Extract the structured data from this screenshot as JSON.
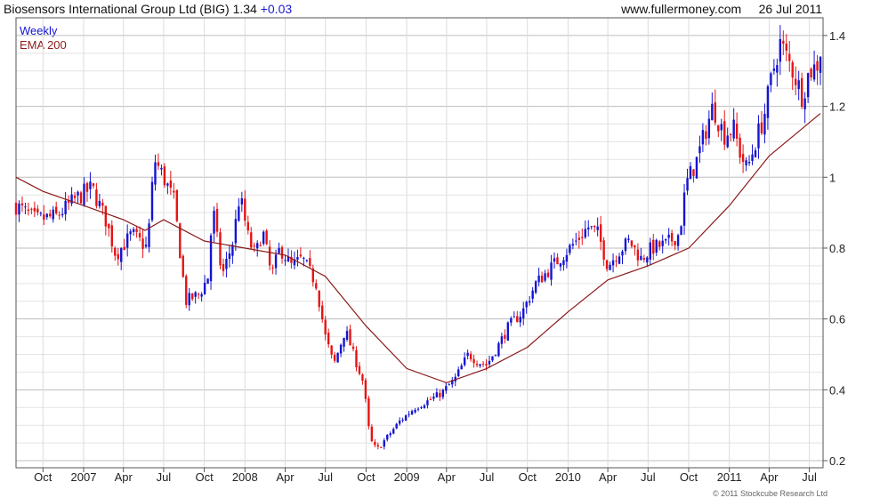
{
  "header": {
    "title": "Biosensors International Group Ltd (BIG) 1.34",
    "change": "+0.03",
    "source": "www.fullermoney.com",
    "date": "26 Jul 2011"
  },
  "legend": {
    "weekly": "Weekly",
    "ema": "EMA 200"
  },
  "copyright": "© 2011 Stockcube Research Ltd",
  "colors": {
    "up": "#1414d2",
    "down": "#e61414",
    "ema": "#8b1a1a",
    "grid": "#cfcfcf",
    "axis": "#555555"
  },
  "chart_data": {
    "type": "candlestick",
    "interval": "weekly",
    "x": {
      "start": "2006-08-01",
      "end": "2011-08-01"
    },
    "x_ticks": [
      {
        "label": "Oct",
        "date": "2006-10-01"
      },
      {
        "label": "2007",
        "date": "2007-01-01"
      },
      {
        "label": "Apr",
        "date": "2007-04-01"
      },
      {
        "label": "Jul",
        "date": "2007-07-01"
      },
      {
        "label": "Oct",
        "date": "2007-10-01"
      },
      {
        "label": "2008",
        "date": "2008-01-01"
      },
      {
        "label": "Apr",
        "date": "2008-04-01"
      },
      {
        "label": "Jul",
        "date": "2008-07-01"
      },
      {
        "label": "Oct",
        "date": "2008-10-01"
      },
      {
        "label": "2009",
        "date": "2009-01-01"
      },
      {
        "label": "Apr",
        "date": "2009-04-01"
      },
      {
        "label": "Jul",
        "date": "2009-07-01"
      },
      {
        "label": "Oct",
        "date": "2009-10-01"
      },
      {
        "label": "2010",
        "date": "2010-01-01"
      },
      {
        "label": "Apr",
        "date": "2010-04-01"
      },
      {
        "label": "Jul",
        "date": "2010-07-01"
      },
      {
        "label": "Oct",
        "date": "2010-10-01"
      },
      {
        "label": "2011",
        "date": "2011-01-01"
      },
      {
        "label": "Apr",
        "date": "2011-04-01"
      },
      {
        "label": "Jul",
        "date": "2011-07-01"
      }
    ],
    "y_ticks": [
      {
        "label": "0.2",
        "value": 0.2
      },
      {
        "label": "0.4",
        "value": 0.4
      },
      {
        "label": "0.6",
        "value": 0.6
      },
      {
        "label": "0.8",
        "value": 0.8
      },
      {
        "label": "1",
        "value": 1.0
      },
      {
        "label": "1.2",
        "value": 1.2
      },
      {
        "label": "1.4",
        "value": 1.4
      }
    ],
    "ylim": [
      0.18,
      1.45
    ],
    "grid": true,
    "close_path": [
      [
        "2006-08-01",
        0.92
      ],
      [
        "2006-09-15",
        0.88
      ],
      [
        "2006-11-01",
        0.89
      ],
      [
        "2006-12-15",
        0.94
      ],
      [
        "2007-01-20",
        0.97
      ],
      [
        "2007-02-20",
        0.88
      ],
      [
        "2007-03-15",
        0.78
      ],
      [
        "2007-04-20",
        0.84
      ],
      [
        "2007-05-25",
        0.8
      ],
      [
        "2007-06-10",
        1.05
      ],
      [
        "2007-07-01",
        1.0
      ],
      [
        "2007-07-25",
        0.93
      ],
      [
        "2007-08-20",
        0.65
      ],
      [
        "2007-09-20",
        0.67
      ],
      [
        "2007-10-10",
        0.72
      ],
      [
        "2007-10-20",
        0.92
      ],
      [
        "2007-11-10",
        0.72
      ],
      [
        "2007-12-05",
        0.82
      ],
      [
        "2007-12-20",
        0.95
      ],
      [
        "2008-01-10",
        0.82
      ],
      [
        "2008-01-25",
        0.78
      ],
      [
        "2008-02-10",
        0.85
      ],
      [
        "2008-03-01",
        0.72
      ],
      [
        "2008-03-20",
        0.8
      ],
      [
        "2008-04-15",
        0.75
      ],
      [
        "2008-05-10",
        0.77
      ],
      [
        "2008-06-10",
        0.7
      ],
      [
        "2008-07-01",
        0.55
      ],
      [
        "2008-07-20",
        0.47
      ],
      [
        "2008-08-15",
        0.57
      ],
      [
        "2008-09-05",
        0.49
      ],
      [
        "2008-09-25",
        0.42
      ],
      [
        "2008-10-10",
        0.26
      ],
      [
        "2008-10-25",
        0.23
      ],
      [
        "2008-11-20",
        0.27
      ],
      [
        "2008-12-15",
        0.31
      ],
      [
        "2009-01-20",
        0.35
      ],
      [
        "2009-02-20",
        0.37
      ],
      [
        "2009-03-20",
        0.39
      ],
      [
        "2009-04-20",
        0.43
      ],
      [
        "2009-05-20",
        0.5
      ],
      [
        "2009-06-10",
        0.48
      ],
      [
        "2009-07-01",
        0.47
      ],
      [
        "2009-07-25",
        0.52
      ],
      [
        "2009-08-20",
        0.58
      ],
      [
        "2009-09-20",
        0.62
      ],
      [
        "2009-10-20",
        0.7
      ],
      [
        "2009-11-20",
        0.74
      ],
      [
        "2009-12-20",
        0.78
      ],
      [
        "2010-01-20",
        0.82
      ],
      [
        "2010-02-15",
        0.86
      ],
      [
        "2010-03-10",
        0.84
      ],
      [
        "2010-04-01",
        0.75
      ],
      [
        "2010-04-25",
        0.79
      ],
      [
        "2010-05-20",
        0.82
      ],
      [
        "2010-06-15",
        0.77
      ],
      [
        "2010-07-10",
        0.8
      ],
      [
        "2010-08-10",
        0.81
      ],
      [
        "2010-09-10",
        0.84
      ],
      [
        "2010-09-25",
        0.98
      ],
      [
        "2010-10-20",
        1.05
      ],
      [
        "2010-11-10",
        1.14
      ],
      [
        "2010-11-25",
        1.2
      ],
      [
        "2010-12-20",
        1.12
      ],
      [
        "2011-01-10",
        1.14
      ],
      [
        "2011-01-25",
        1.07
      ],
      [
        "2011-02-10",
        1.02
      ],
      [
        "2011-03-01",
        1.1
      ],
      [
        "2011-03-20",
        1.17
      ],
      [
        "2011-04-10",
        1.3
      ],
      [
        "2011-04-25",
        1.38
      ],
      [
        "2011-05-10",
        1.34
      ],
      [
        "2011-05-25",
        1.3
      ],
      [
        "2011-06-15",
        1.23
      ],
      [
        "2011-07-01",
        1.3
      ],
      [
        "2011-07-15",
        1.31
      ],
      [
        "2011-07-26",
        1.34
      ]
    ],
    "ema_200": [
      [
        "2006-08-01",
        1.0
      ],
      [
        "2006-10-01",
        0.96
      ],
      [
        "2007-01-01",
        0.92
      ],
      [
        "2007-04-01",
        0.88
      ],
      [
        "2007-05-20",
        0.85
      ],
      [
        "2007-07-01",
        0.88
      ],
      [
        "2007-10-01",
        0.82
      ],
      [
        "2008-01-01",
        0.8
      ],
      [
        "2008-04-01",
        0.78
      ],
      [
        "2008-07-01",
        0.72
      ],
      [
        "2008-10-01",
        0.58
      ],
      [
        "2009-01-01",
        0.46
      ],
      [
        "2009-04-01",
        0.42
      ],
      [
        "2009-07-01",
        0.46
      ],
      [
        "2009-10-01",
        0.52
      ],
      [
        "2010-01-01",
        0.62
      ],
      [
        "2010-04-01",
        0.71
      ],
      [
        "2010-07-01",
        0.75
      ],
      [
        "2010-10-01",
        0.8
      ],
      [
        "2011-01-01",
        0.92
      ],
      [
        "2011-04-01",
        1.06
      ],
      [
        "2011-07-26",
        1.18
      ]
    ]
  }
}
